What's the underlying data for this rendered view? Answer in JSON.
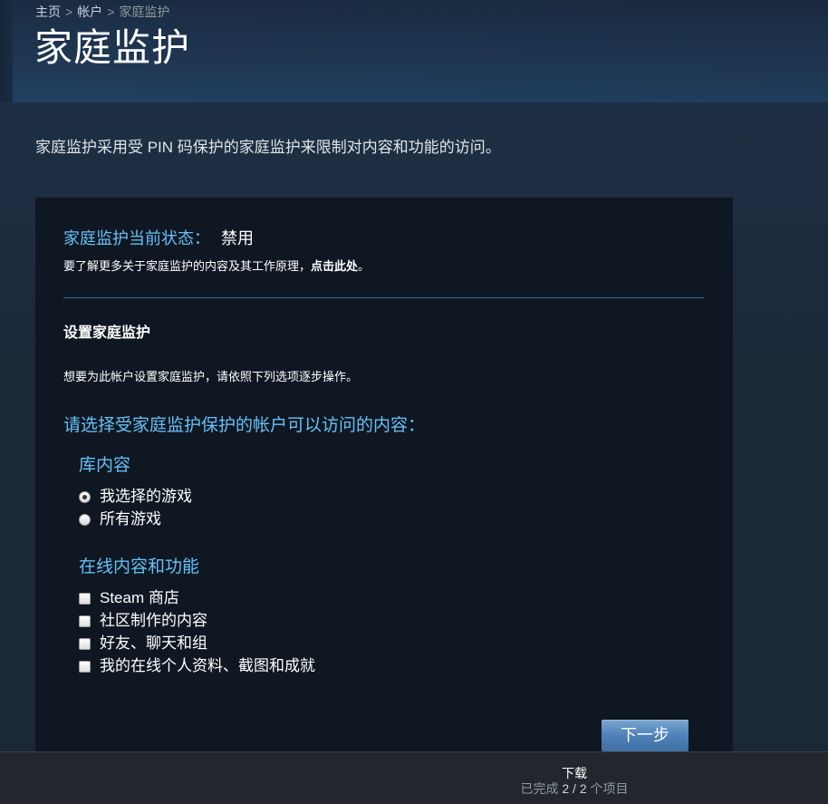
{
  "breadcrumb": {
    "items": [
      "主页",
      "帐户",
      "家庭监护"
    ],
    "separator": ">"
  },
  "page": {
    "title": "家庭监护",
    "intro": "家庭监护采用受 PIN 码保护的家庭监护来限制对内容和功能的访问。"
  },
  "status": {
    "label": "家庭监护当前状态：",
    "value": "禁用",
    "learn_more_text": "要了解更多关于家庭监护的内容及其工作原理，",
    "learn_more_link": "点击此处",
    "learn_more_suffix": "。"
  },
  "setup": {
    "title": "设置家庭监护",
    "description": "想要为此帐户设置家庭监护，请依照下列选项逐步操作。",
    "choose_heading": "请选择受家庭监护保护的帐户可以访问的内容：",
    "library": {
      "heading": "库内容",
      "options": [
        {
          "label": "我选择的游戏",
          "selected": true
        },
        {
          "label": "所有游戏",
          "selected": false
        }
      ]
    },
    "online": {
      "heading": "在线内容和功能",
      "options": [
        {
          "label": "Steam 商店",
          "checked": false
        },
        {
          "label": "社区制作的内容",
          "checked": false
        },
        {
          "label": "好友、聊天和组",
          "checked": false
        },
        {
          "label": "我的在线个人资料、截图和成就",
          "checked": false
        }
      ]
    },
    "next_button": "下一步"
  },
  "footer": {
    "title": "下载",
    "status_prefix": "已完成",
    "status_count": "2 / 2",
    "status_suffix": "个项目"
  },
  "colors": {
    "accent_blue": "#66c0f4",
    "background": "#1b2838",
    "panel": "#0f1723",
    "button": "#4f82b8"
  }
}
